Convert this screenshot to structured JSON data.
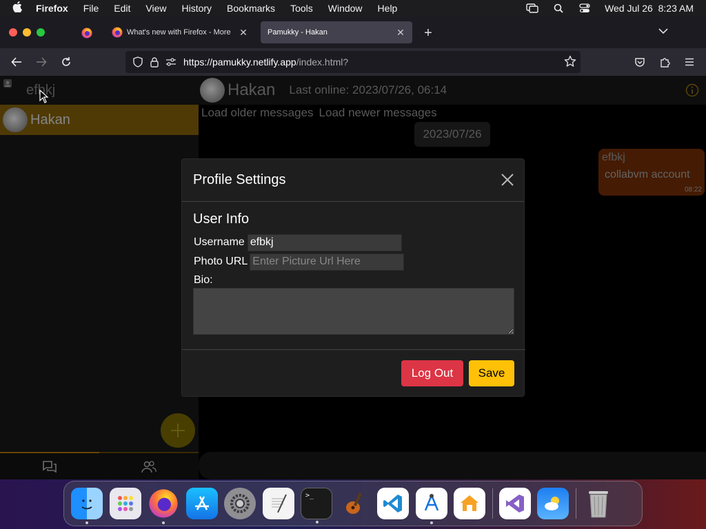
{
  "menubar": {
    "app_name": "Firefox",
    "items": [
      "File",
      "Edit",
      "View",
      "History",
      "Bookmarks",
      "Tools",
      "Window",
      "Help"
    ],
    "clock": "Wed Jul 26  8:23 AM"
  },
  "browser": {
    "tabs": [
      {
        "title": "What's new with Firefox - More",
        "icon": "firefox-icon"
      },
      {
        "title": "Pamukky - Hakan",
        "icon": "none",
        "active": true
      }
    ],
    "url_host": "https://pamukky.netlify.app",
    "url_path": "/index.html?"
  },
  "app": {
    "sidebar": {
      "current_user": "efbkj",
      "chats": [
        {
          "name": "Hakan"
        }
      ]
    },
    "chat": {
      "title": "Hakan",
      "last_online": "Last online: 2023/07/26, 06:14",
      "load_older": "Load older messages",
      "load_newer": "Load newer messages",
      "date_chip": "2023/07/26",
      "messages": [
        {
          "sender": "efbkj",
          "text": "collabvm account",
          "time": "08:22"
        }
      ]
    }
  },
  "modal": {
    "title": "Profile Settings",
    "section_title": "User Info",
    "username_label": "Username",
    "username_value": "efbkj",
    "photo_label": "Photo URL",
    "photo_placeholder": "Enter Picture Url Here",
    "bio_label": "Bio:",
    "logout_label": "Log Out",
    "save_label": "Save"
  },
  "colors": {
    "logout": "#dc3545",
    "save": "#ffc107",
    "selected_chat": "#7a5a09",
    "message_bubble": "#6a2a05"
  },
  "dock": {
    "apps": [
      "finder-icon",
      "launchpad-icon",
      "firefox-icon",
      "app-store-icon",
      "system-settings-icon",
      "textedit-icon",
      "terminal-icon",
      "garageband-icon",
      "vscode-icon",
      "xcode-instruments-icon",
      "home-icon",
      "visual-studio-icon",
      "weather-icon",
      "trash-icon"
    ]
  }
}
